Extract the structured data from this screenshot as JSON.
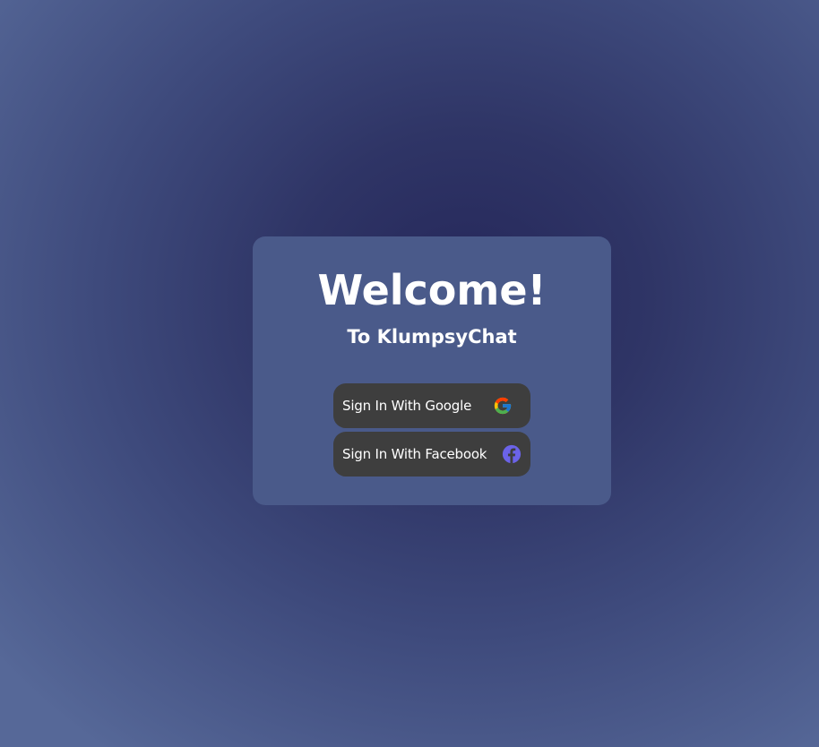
{
  "card": {
    "title": "Welcome!",
    "subtitle": "To KlumpsyChat"
  },
  "buttons": {
    "google": {
      "label": "Sign In With Google",
      "icon": "google-icon"
    },
    "facebook": {
      "label": "Sign In With Facebook",
      "icon": "facebook-icon"
    }
  },
  "colors": {
    "card_bg": "#4a5a8a",
    "button_bg": "#3e3e3e",
    "facebook_icon": "#6b63e8",
    "text": "#ffffff"
  }
}
